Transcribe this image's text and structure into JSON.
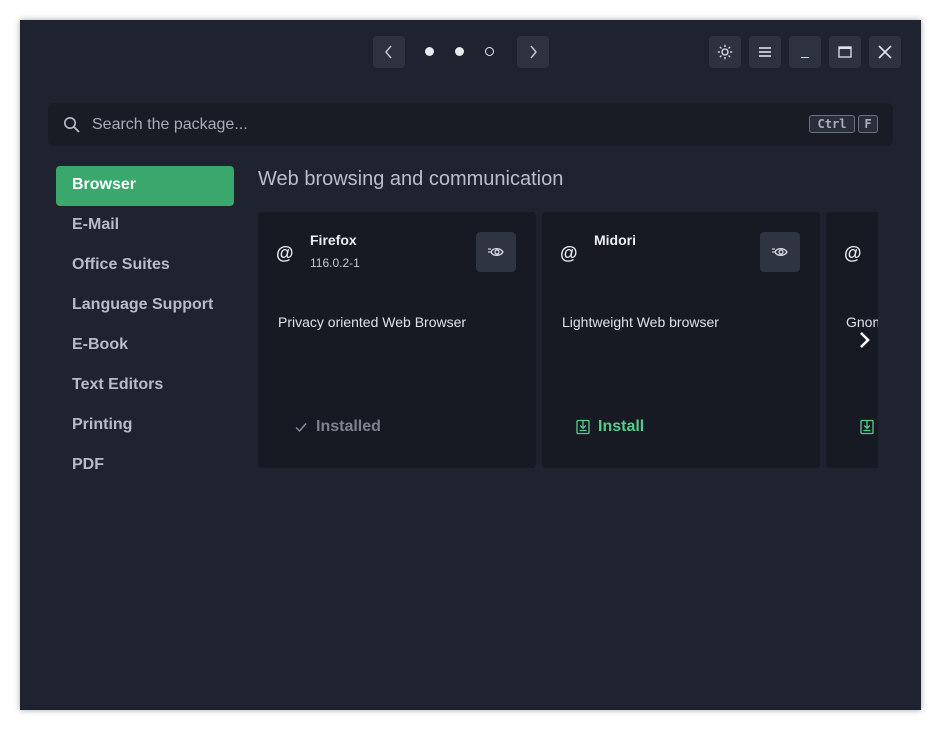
{
  "header": {
    "prev_icon": "chevron-left-icon",
    "next_icon": "chevron-right-icon",
    "pager_dots": [
      "filled",
      "filled",
      "empty"
    ],
    "theme_icon": "sun-icon",
    "menu_icon": "hamburger-icon",
    "minimize_label": "_",
    "maximize_icon": "maximize-icon",
    "close_icon": "close-icon"
  },
  "search": {
    "placeholder": "Search the package...",
    "value": "",
    "shortcut_keys": [
      "Ctrl",
      "F"
    ]
  },
  "sidebar": {
    "items": [
      {
        "label": "Browser",
        "active": true
      },
      {
        "label": "E-Mail",
        "active": false
      },
      {
        "label": "Office Suites",
        "active": false
      },
      {
        "label": "Language Support",
        "active": false
      },
      {
        "label": "E-Book",
        "active": false
      },
      {
        "label": "Text Editors",
        "active": false
      },
      {
        "label": "Printing",
        "active": false
      },
      {
        "label": "PDF",
        "active": false
      }
    ]
  },
  "main": {
    "section_title": "Web browsing and communication",
    "cards": [
      {
        "name": "Firefox",
        "version": "116.0.2-1",
        "description": "Privacy oriented Web Browser",
        "action_label": "Installed",
        "action_state": "installed"
      },
      {
        "name": "Midori",
        "version": "",
        "description": "Lightweight Web browser",
        "action_label": "Install",
        "action_state": "install"
      },
      {
        "name": "",
        "version": "",
        "description": "Gnome Web",
        "action_label": "",
        "action_state": "install"
      }
    ]
  },
  "colors": {
    "window_bg": "#1f2330",
    "accent": "#3aa76d",
    "install_text": "#58cc8a",
    "card_bg": "#171a23"
  }
}
